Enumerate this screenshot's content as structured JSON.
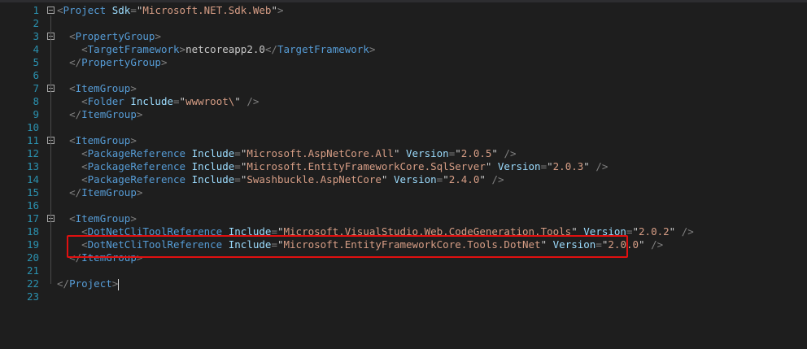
{
  "editor": {
    "lines": [
      {
        "n": "1",
        "tokens": [
          [
            "b",
            "<"
          ],
          [
            "t",
            "Project"
          ],
          [
            "q",
            " "
          ],
          [
            "a",
            "Sdk"
          ],
          [
            "b",
            "="
          ],
          [
            "q",
            "\""
          ],
          [
            "v",
            "Microsoft.NET.Sdk.Web"
          ],
          [
            "q",
            "\""
          ],
          [
            "b",
            ">"
          ]
        ]
      },
      {
        "n": "2",
        "tokens": []
      },
      {
        "n": "3",
        "tokens": [
          [
            "q",
            "  "
          ],
          [
            "b",
            "<"
          ],
          [
            "t",
            "PropertyGroup"
          ],
          [
            "b",
            ">"
          ]
        ]
      },
      {
        "n": "4",
        "tokens": [
          [
            "q",
            "    "
          ],
          [
            "b",
            "<"
          ],
          [
            "t",
            "TargetFramework"
          ],
          [
            "b",
            ">"
          ],
          [
            "q",
            "netcoreapp2.0"
          ],
          [
            "b",
            "</"
          ],
          [
            "t",
            "TargetFramework"
          ],
          [
            "b",
            ">"
          ]
        ]
      },
      {
        "n": "5",
        "tokens": [
          [
            "q",
            "  "
          ],
          [
            "b",
            "</"
          ],
          [
            "t",
            "PropertyGroup"
          ],
          [
            "b",
            ">"
          ]
        ]
      },
      {
        "n": "6",
        "tokens": []
      },
      {
        "n": "7",
        "tokens": [
          [
            "q",
            "  "
          ],
          [
            "b",
            "<"
          ],
          [
            "t",
            "ItemGroup"
          ],
          [
            "b",
            ">"
          ]
        ]
      },
      {
        "n": "8",
        "tokens": [
          [
            "q",
            "    "
          ],
          [
            "b",
            "<"
          ],
          [
            "t",
            "Folder"
          ],
          [
            "q",
            " "
          ],
          [
            "a",
            "Include"
          ],
          [
            "b",
            "="
          ],
          [
            "q",
            "\""
          ],
          [
            "v",
            "wwwroot\\"
          ],
          [
            "q",
            "\""
          ],
          [
            "q",
            " "
          ],
          [
            "b",
            "/>"
          ]
        ]
      },
      {
        "n": "9",
        "tokens": [
          [
            "q",
            "  "
          ],
          [
            "b",
            "</"
          ],
          [
            "t",
            "ItemGroup"
          ],
          [
            "b",
            ">"
          ]
        ]
      },
      {
        "n": "10",
        "tokens": []
      },
      {
        "n": "11",
        "tokens": [
          [
            "q",
            "  "
          ],
          [
            "b",
            "<"
          ],
          [
            "t",
            "ItemGroup"
          ],
          [
            "b",
            ">"
          ]
        ]
      },
      {
        "n": "12",
        "tokens": [
          [
            "q",
            "    "
          ],
          [
            "b",
            "<"
          ],
          [
            "t",
            "PackageReference"
          ],
          [
            "q",
            " "
          ],
          [
            "a",
            "Include"
          ],
          [
            "b",
            "="
          ],
          [
            "q",
            "\""
          ],
          [
            "v",
            "Microsoft.AspNetCore.All"
          ],
          [
            "q",
            "\""
          ],
          [
            "q",
            " "
          ],
          [
            "a",
            "Version"
          ],
          [
            "b",
            "="
          ],
          [
            "q",
            "\""
          ],
          [
            "v",
            "2.0.5"
          ],
          [
            "q",
            "\""
          ],
          [
            "q",
            " "
          ],
          [
            "b",
            "/>"
          ]
        ]
      },
      {
        "n": "13",
        "tokens": [
          [
            "q",
            "    "
          ],
          [
            "b",
            "<"
          ],
          [
            "t",
            "PackageReference"
          ],
          [
            "q",
            " "
          ],
          [
            "a",
            "Include"
          ],
          [
            "b",
            "="
          ],
          [
            "q",
            "\""
          ],
          [
            "v",
            "Microsoft.EntityFrameworkCore.SqlServer"
          ],
          [
            "q",
            "\""
          ],
          [
            "q",
            " "
          ],
          [
            "a",
            "Version"
          ],
          [
            "b",
            "="
          ],
          [
            "q",
            "\""
          ],
          [
            "v",
            "2.0.3"
          ],
          [
            "q",
            "\""
          ],
          [
            "q",
            " "
          ],
          [
            "b",
            "/>"
          ]
        ]
      },
      {
        "n": "14",
        "tokens": [
          [
            "q",
            "    "
          ],
          [
            "b",
            "<"
          ],
          [
            "t",
            "PackageReference"
          ],
          [
            "q",
            " "
          ],
          [
            "a",
            "Include"
          ],
          [
            "b",
            "="
          ],
          [
            "q",
            "\""
          ],
          [
            "v",
            "Swashbuckle.AspNetCore"
          ],
          [
            "q",
            "\""
          ],
          [
            "q",
            " "
          ],
          [
            "a",
            "Version"
          ],
          [
            "b",
            "="
          ],
          [
            "q",
            "\""
          ],
          [
            "v",
            "2.4.0"
          ],
          [
            "q",
            "\""
          ],
          [
            "q",
            " "
          ],
          [
            "b",
            "/>"
          ]
        ]
      },
      {
        "n": "15",
        "tokens": [
          [
            "q",
            "  "
          ],
          [
            "b",
            "</"
          ],
          [
            "t",
            "ItemGroup"
          ],
          [
            "b",
            ">"
          ]
        ]
      },
      {
        "n": "16",
        "tokens": []
      },
      {
        "n": "17",
        "tokens": [
          [
            "q",
            "  "
          ],
          [
            "b",
            "<"
          ],
          [
            "t",
            "ItemGroup"
          ],
          [
            "b",
            ">"
          ]
        ]
      },
      {
        "n": "18",
        "tokens": [
          [
            "q",
            "    "
          ],
          [
            "b",
            "<"
          ],
          [
            "t",
            "DotNetCliToolReference"
          ],
          [
            "q",
            " "
          ],
          [
            "a",
            "Include"
          ],
          [
            "b",
            "="
          ],
          [
            "q",
            "\""
          ],
          [
            "v",
            "Microsoft.VisualStudio.Web.CodeGeneration.Tools"
          ],
          [
            "q",
            "\""
          ],
          [
            "q",
            " "
          ],
          [
            "a",
            "Version"
          ],
          [
            "b",
            "="
          ],
          [
            "q",
            "\""
          ],
          [
            "v",
            "2.0.2"
          ],
          [
            "q",
            "\""
          ],
          [
            "q",
            " "
          ],
          [
            "b",
            "/>"
          ]
        ]
      },
      {
        "n": "19",
        "tokens": [
          [
            "q",
            "    "
          ],
          [
            "b",
            "<"
          ],
          [
            "t",
            "DotNetCliToolReference"
          ],
          [
            "q",
            " "
          ],
          [
            "a",
            "Include"
          ],
          [
            "b",
            "="
          ],
          [
            "q",
            "\""
          ],
          [
            "v",
            "Microsoft.EntityFrameworkCore.Tools.DotNet"
          ],
          [
            "q",
            "\""
          ],
          [
            "q",
            " "
          ],
          [
            "a",
            "Version"
          ],
          [
            "b",
            "="
          ],
          [
            "q",
            "\""
          ],
          [
            "v",
            "2.0.0"
          ],
          [
            "q",
            "\""
          ],
          [
            "q",
            " "
          ],
          [
            "b",
            "/>"
          ]
        ]
      },
      {
        "n": "20",
        "tokens": [
          [
            "q",
            "  "
          ],
          [
            "b",
            "</"
          ],
          [
            "t",
            "ItemGroup"
          ],
          [
            "b",
            ">"
          ]
        ]
      },
      {
        "n": "21",
        "tokens": []
      },
      {
        "n": "22",
        "tokens": [
          [
            "b",
            "</"
          ],
          [
            "t",
            "Project"
          ],
          [
            "b",
            ">"
          ]
        ]
      },
      {
        "n": "23",
        "tokens": []
      }
    ],
    "fold_lines": [
      "1",
      "3",
      "7",
      "11",
      "17"
    ],
    "highlight_line": "19",
    "colors": {
      "background": "#1e1e1e",
      "line_number": "#2b91af",
      "tag": "#569cd6",
      "attribute": "#9cdcfe",
      "value": "#d69d85",
      "bracket": "#808080",
      "highlight_box": "#e01010"
    }
  }
}
